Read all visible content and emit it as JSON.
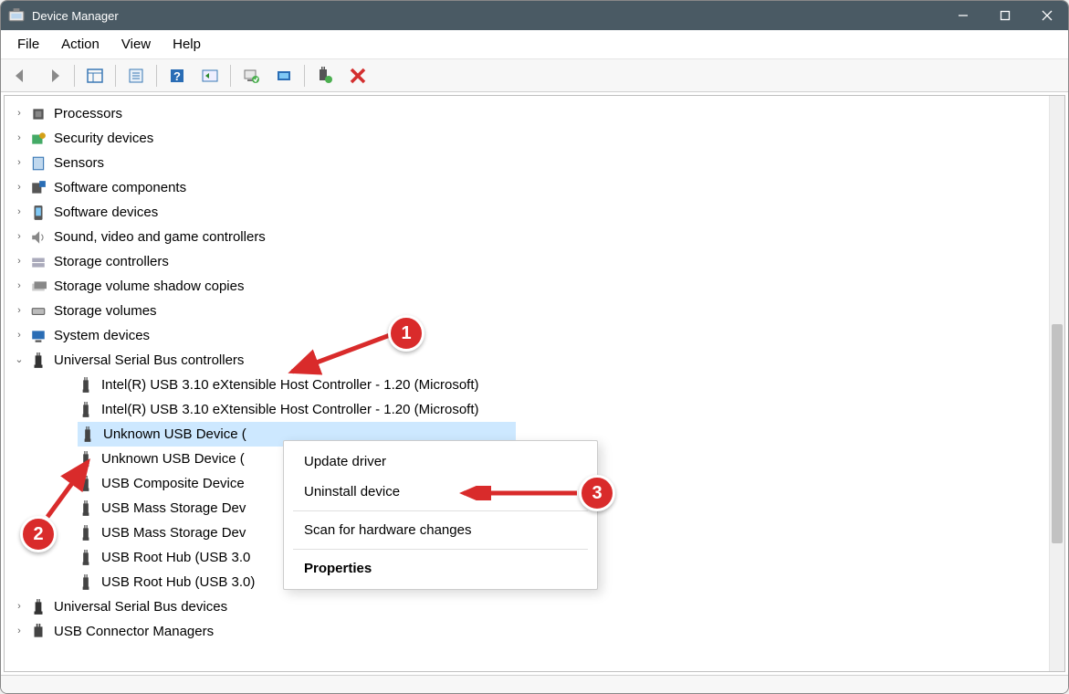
{
  "title": "Device Manager",
  "menu": {
    "file": "File",
    "action": "Action",
    "view": "View",
    "help": "Help"
  },
  "tree": {
    "categories": [
      {
        "label": "Processors",
        "expanded": false
      },
      {
        "label": "Security devices",
        "expanded": false
      },
      {
        "label": "Sensors",
        "expanded": false
      },
      {
        "label": "Software components",
        "expanded": false
      },
      {
        "label": "Software devices",
        "expanded": false
      },
      {
        "label": "Sound, video and game controllers",
        "expanded": false
      },
      {
        "label": "Storage controllers",
        "expanded": false
      },
      {
        "label": "Storage volume shadow copies",
        "expanded": false
      },
      {
        "label": "Storage volumes",
        "expanded": false
      },
      {
        "label": "System devices",
        "expanded": false
      },
      {
        "label": "Universal Serial Bus controllers",
        "expanded": true,
        "children": [
          {
            "label": "Intel(R) USB 3.10 eXtensible Host Controller - 1.20 (Microsoft)"
          },
          {
            "label": "Intel(R) USB 3.10 eXtensible Host Controller - 1.20 (Microsoft)"
          },
          {
            "label": "Unknown USB Device (",
            "selected": true
          },
          {
            "label": "Unknown USB Device ("
          },
          {
            "label": "USB Composite Device"
          },
          {
            "label": "USB Mass Storage Dev"
          },
          {
            "label": "USB Mass Storage Dev"
          },
          {
            "label": "USB Root Hub (USB 3.0"
          },
          {
            "label": "USB Root Hub (USB 3.0)"
          }
        ]
      },
      {
        "label": "Universal Serial Bus devices",
        "expanded": false
      },
      {
        "label": "USB Connector Managers",
        "expanded": false
      }
    ]
  },
  "context_menu": {
    "update": "Update driver",
    "uninstall": "Uninstall device",
    "scan": "Scan for hardware changes",
    "properties": "Properties"
  },
  "annotations": {
    "b1": "1",
    "b2": "2",
    "b3": "3"
  }
}
